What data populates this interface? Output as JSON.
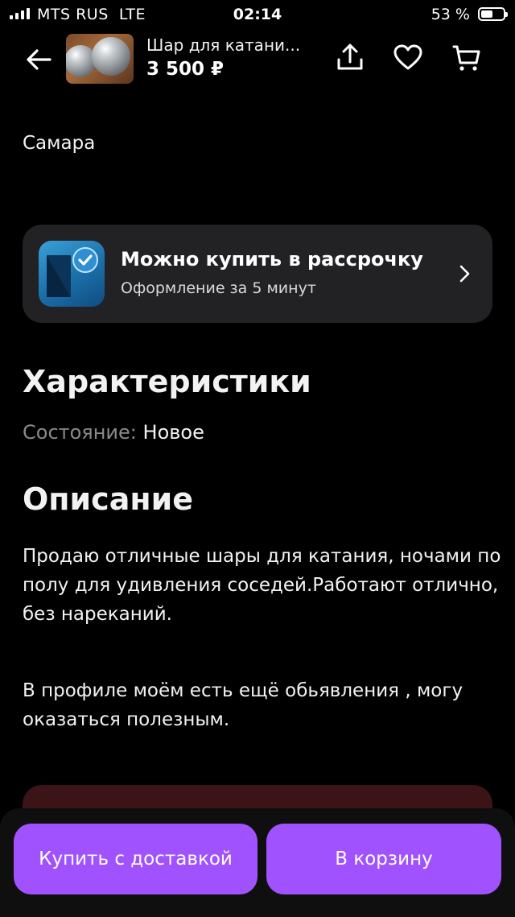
{
  "status_bar": {
    "carrier": "MTS RUS",
    "network": "LTE",
    "time": "02:14",
    "battery_percent_text": "53 %",
    "battery_level": 0.53
  },
  "header": {
    "title": "Шар для катани...",
    "price": "3 500 ₽",
    "icons": [
      "back-arrow-icon",
      "share-icon",
      "heart-icon",
      "cart-icon"
    ]
  },
  "location": {
    "city": "Самара"
  },
  "installment": {
    "title": "Можно купить в рассрочку",
    "subtitle": "Оформление за 5 минут"
  },
  "characteristics": {
    "heading": "Характеристики",
    "condition_label": "Состояние:",
    "condition_value": "Новое"
  },
  "description": {
    "heading": "Описание",
    "paragraph_1": "Продаю отличные шары для катания, ночами по полу для удивления соседей.Работают отлично, без нареканий.",
    "paragraph_2": "В профиле моём есть ещё обьявления , могу оказаться полезным."
  },
  "actions": {
    "buy_with_delivery": "Купить с доставкой",
    "add_to_cart": "В корзину"
  },
  "colors": {
    "background": "#000000",
    "card": "#222224",
    "accent": "#a052ff",
    "muted_text": "#8a8a8a"
  }
}
